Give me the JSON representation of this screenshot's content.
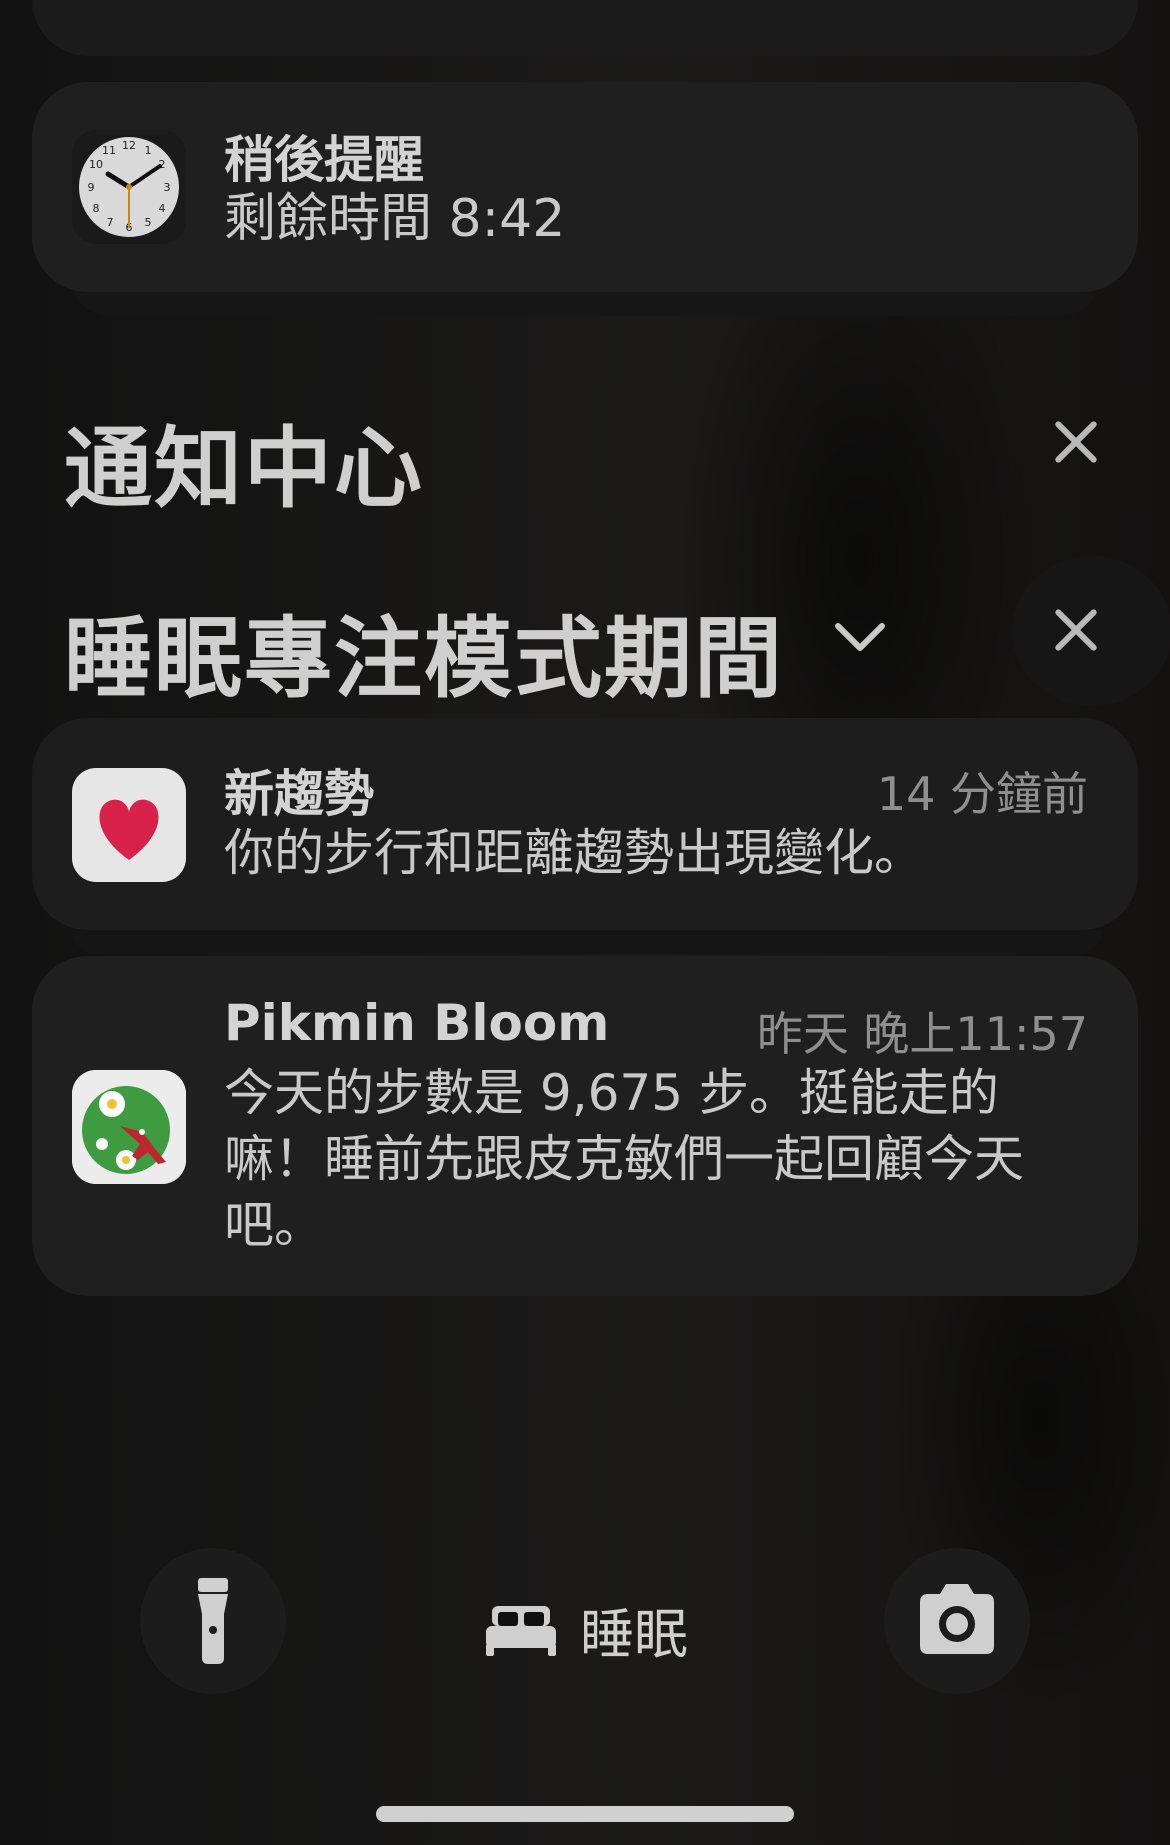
{
  "timer_card": {
    "app_icon": "clock-icon",
    "title": "稍後提醒",
    "subtitle": "剩餘時間 8:42"
  },
  "notification_center": {
    "title": "通知中心"
  },
  "focus_section": {
    "title": "睡眠專注模式期間"
  },
  "notifications": [
    {
      "app_icon": "health-heart-icon",
      "title": "新趨勢",
      "time": "14 分鐘前",
      "body": "你的步行和距離趨勢出現變化。"
    },
    {
      "app_icon": "pikmin-bloom-icon",
      "title": "Pikmin Bloom",
      "time": "昨天 晚上11:57",
      "body": "今天的步數是 9,675 步。挺能走的嘛！睡前先跟皮克敏們一起回顧今天吧。"
    }
  ],
  "bottom_bar": {
    "left_icon": "flashlight-icon",
    "center_icon": "bed-icon",
    "center_label": "睡眠",
    "right_icon": "camera-icon"
  },
  "colors": {
    "background": "#101010",
    "card": "#1f1f1f",
    "heart": "#d8224b",
    "pikmin_green": "#3f9b3f"
  }
}
